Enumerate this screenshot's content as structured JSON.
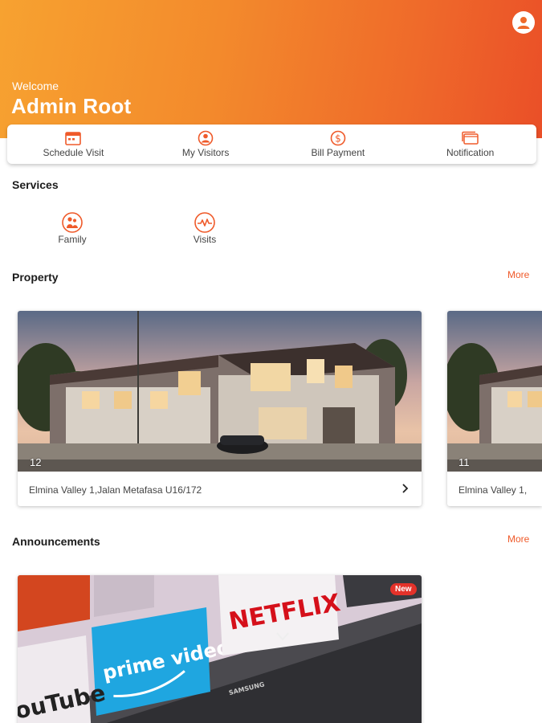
{
  "header": {
    "welcome": "Welcome",
    "user_name": "Admin Root"
  },
  "quick_actions": [
    {
      "label": "Schedule Visit",
      "icon": "calendar-icon"
    },
    {
      "label": "My Visitors",
      "icon": "visitor-icon"
    },
    {
      "label": "Bill Payment",
      "icon": "dollar-icon"
    },
    {
      "label": "Notification",
      "icon": "notification-icon"
    }
  ],
  "services": {
    "title": "Services",
    "items": [
      {
        "label": "Family",
        "icon": "family-icon"
      },
      {
        "label": "Visits",
        "icon": "visits-icon"
      }
    ]
  },
  "property": {
    "title": "Property",
    "more": "More",
    "cards": [
      {
        "count": "12",
        "address": "Elmina Valley 1,Jalan Metafasa U16/172"
      },
      {
        "count": "11",
        "address": "Elmina Valley 1,"
      }
    ]
  },
  "announcements": {
    "title": "Announcements",
    "more": "More",
    "badge": "New",
    "image_brands": [
      "prime video",
      "NETFLIX",
      "ouTube",
      "SAMSUNG"
    ]
  },
  "colors": {
    "accent": "#ef5a2a",
    "header_start": "#f7a230",
    "header_end": "#ea4f28"
  }
}
